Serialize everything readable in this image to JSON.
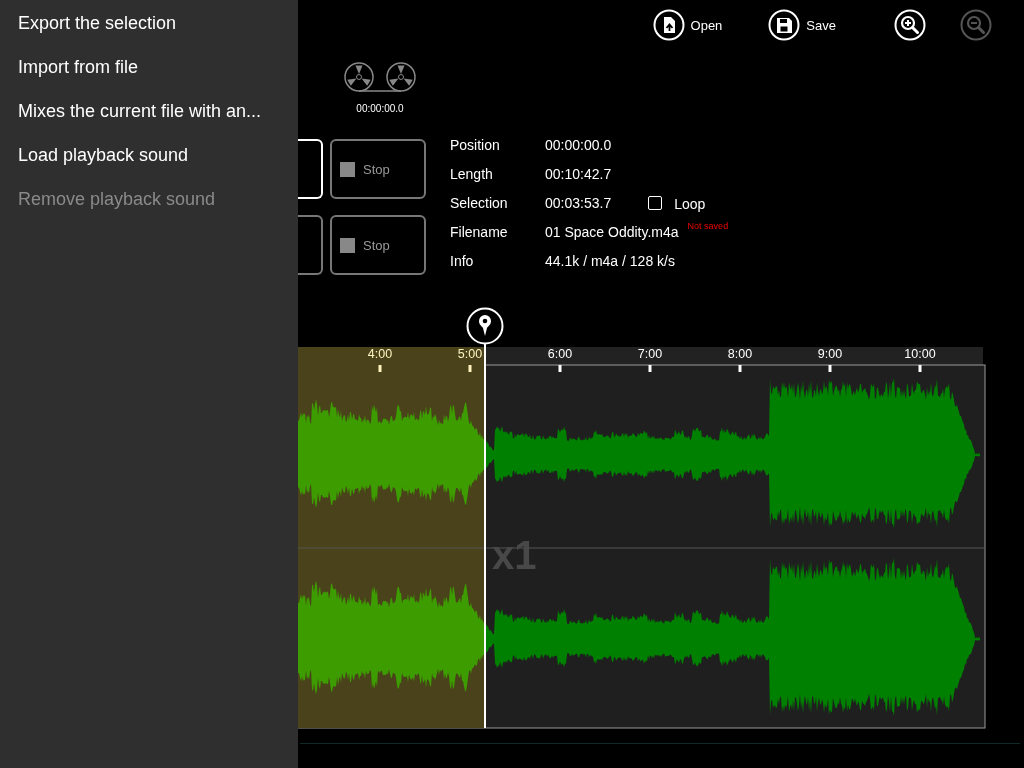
{
  "menu": {
    "items": [
      {
        "label": "Export the selection",
        "disabled": false
      },
      {
        "label": "Import from file",
        "disabled": false
      },
      {
        "label": "Mixes the current file with an...",
        "disabled": false
      },
      {
        "label": "Load playback sound",
        "disabled": false
      },
      {
        "label": "Remove playback sound",
        "disabled": true
      }
    ]
  },
  "toolbar": {
    "items": [
      {
        "kind": "open",
        "label": "Open",
        "disabled": false
      },
      {
        "kind": "save",
        "label": "Save",
        "disabled": false
      },
      {
        "kind": "zoom_in",
        "disabled": false
      },
      {
        "kind": "zoom_out",
        "disabled": true
      }
    ]
  },
  "tape_counter": "00:00:00.0",
  "transport": {
    "rows": [
      [
        {
          "kind": "clipped",
          "selected": true
        },
        {
          "kind": "stop",
          "label": "Stop",
          "selected": false
        }
      ],
      [
        {
          "kind": "clipped",
          "selected": false
        },
        {
          "kind": "stop",
          "label": "Stop",
          "selected": false
        }
      ]
    ]
  },
  "info": {
    "rows": [
      {
        "label": "Position",
        "value": "00:00:00.0"
      },
      {
        "label": "Length",
        "value": "00:10:42.7"
      },
      {
        "label": "Selection",
        "value": "00:03:53.7",
        "loop": {
          "label": "Loop",
          "checked": false
        }
      },
      {
        "label": "Filename",
        "value": "01 Space Oddity.m4a",
        "note": "Not saved"
      },
      {
        "label": "Info",
        "value": "44.1k / m4a / 128 k/s"
      }
    ]
  },
  "timeline": {
    "labels": [
      "4:00",
      "5:00",
      "6:00",
      "7:00",
      "8:00",
      "9:00",
      "10:00"
    ],
    "zoom": "x1"
  }
}
